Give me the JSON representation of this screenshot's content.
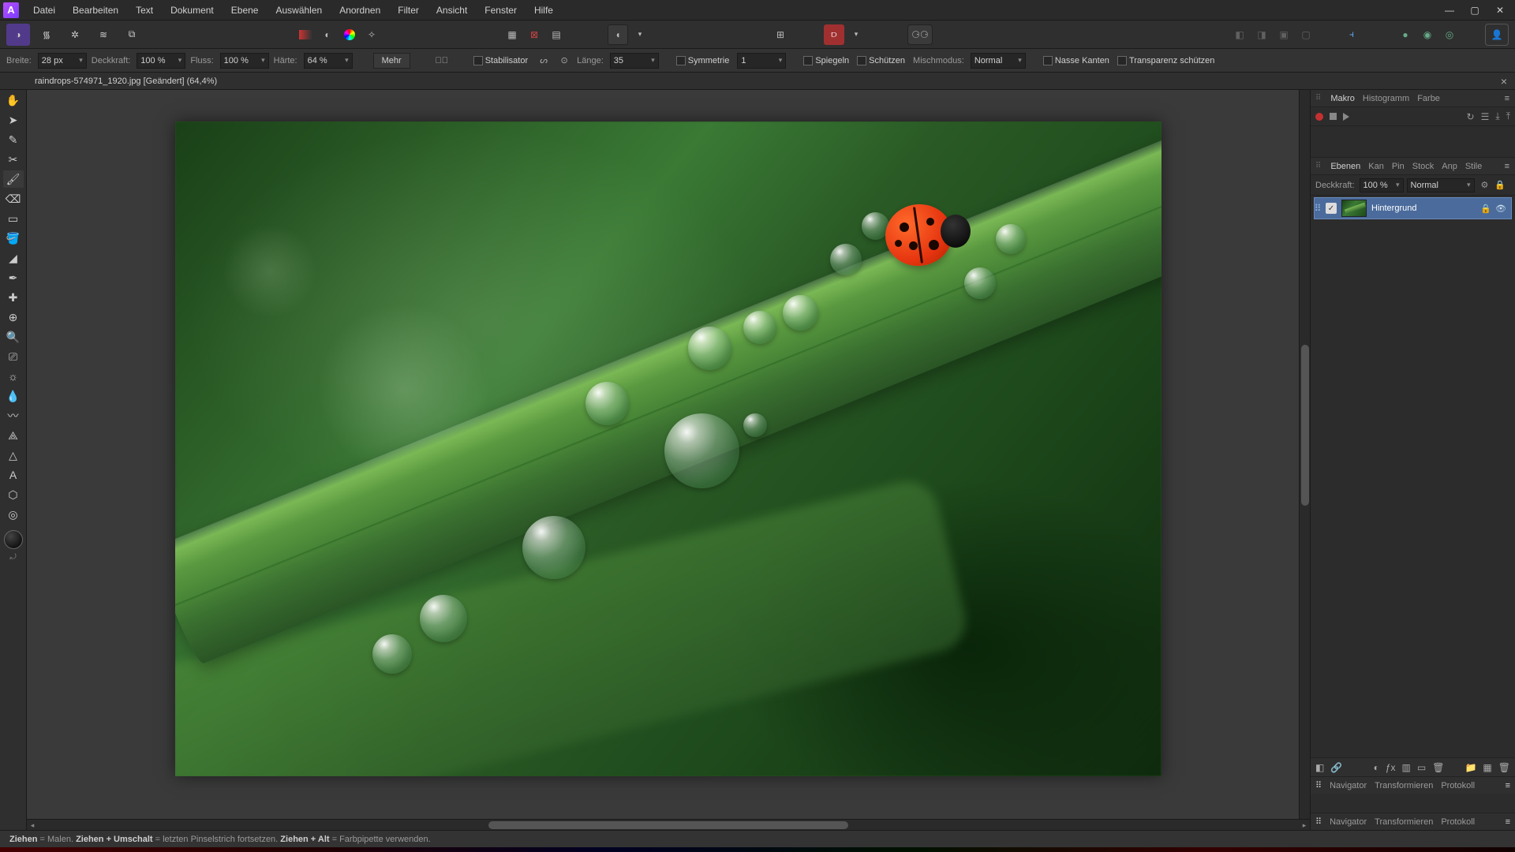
{
  "menu": [
    "Datei",
    "Bearbeiten",
    "Text",
    "Dokument",
    "Ebene",
    "Auswählen",
    "Anordnen",
    "Filter",
    "Ansicht",
    "Fenster",
    "Hilfe"
  ],
  "context": {
    "width_label": "Breite:",
    "width_val": "28 px",
    "opacity_label": "Deckkraft:",
    "opacity_val": "100 %",
    "flow_label": "Fluss:",
    "flow_val": "100 %",
    "hardness_label": "Härte:",
    "hardness_val": "64 %",
    "more": "Mehr",
    "stabilizer": "Stabilisator",
    "length_label": "Länge:",
    "length_val": "35",
    "symmetry": "Symmetrie",
    "symmetry_val": "1",
    "mirror": "Spiegeln",
    "protect": "Schützen",
    "blend_label": "Mischmodus:",
    "blend_val": "Normal",
    "wet": "Nasse Kanten",
    "alpha": "Transparenz schützen"
  },
  "doc_tab": "raindrops-574971_1920.jpg [Geändert] (64,4%)",
  "right": {
    "tabs1": [
      "Makro",
      "Histogramm",
      "Farbe"
    ],
    "tabs2": [
      "Ebenen",
      "Kan",
      "Pin",
      "Stock",
      "Anp",
      "Stile"
    ],
    "opacity_label": "Deckkraft:",
    "opacity_val": "100 %",
    "blend_val": "Normal",
    "layer_name": "Hintergrund",
    "tabs3": [
      "Navigator",
      "Transformieren",
      "Protokoll"
    ],
    "tabs4": [
      "Navigator",
      "Transformieren",
      "Protokoll"
    ]
  },
  "status": {
    "s1": "Ziehen",
    "s1b": " = Malen. ",
    "s2": "Ziehen + Umschalt",
    "s2b": " = letzten Pinselstrich fortsetzen. ",
    "s3": "Ziehen + Alt",
    "s3b": " = Farbpipette verwenden."
  }
}
